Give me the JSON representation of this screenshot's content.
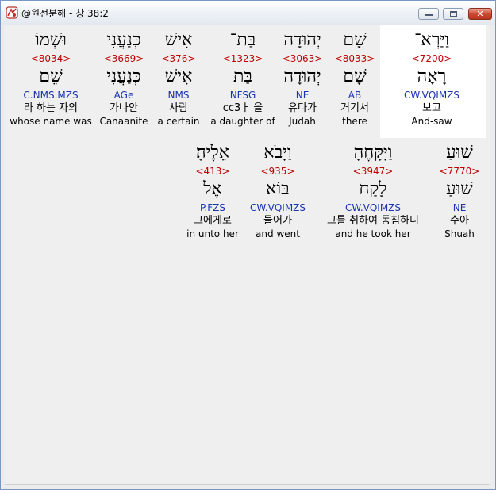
{
  "window": {
    "title": "@원전분해 - 창 38:2",
    "icon": "app-logo-icon",
    "close_glyph": "✕"
  },
  "colors": {
    "strong": "#c00000",
    "morph": "#1a33b0",
    "highlight": "#ffffff",
    "background": "#efefef"
  },
  "rows": [
    {
      "words": [
        {
          "hebrew": "וַיַּרְא־",
          "strong": "<7200>",
          "lemma": "רָאָה",
          "morph": "CW.VQIMZS",
          "korean": "보고",
          "english": "And-saw",
          "highlighted": true
        },
        {
          "hebrew": "שָׁם",
          "strong": "<8033>",
          "lemma": "שָׁם",
          "morph": "AB",
          "korean": "거기서",
          "english": "there"
        },
        {
          "hebrew": "יְהוּדָה",
          "strong": "<3063>",
          "lemma": "יְהוּדָה",
          "morph": "NE",
          "korean": "유다가",
          "english": "Judah"
        },
        {
          "hebrew": "בַּת־",
          "strong": "<1323>",
          "lemma": "בַּת",
          "morph": "NFSG",
          "korean": "cc3ㅏ 을",
          "english": "a daughter of"
        },
        {
          "hebrew": "אִישׁ",
          "strong": "<376>",
          "lemma": "אִישׁ",
          "morph": "NMS",
          "korean": "사람",
          "english": "a certain"
        },
        {
          "hebrew": "כְּנַעֲנִי",
          "strong": "<3669>",
          "lemma": "כְּנַעֲנִי",
          "morph": "AGe",
          "korean": "가나안",
          "english": "Canaanite"
        },
        {
          "hebrew": "וּשְׁמוֹ",
          "strong": "<8034>",
          "lemma": "שֵׁם",
          "morph": "C.NMS.MZS",
          "korean": "라 하는 자의",
          "english": "whose name was"
        }
      ]
    },
    {
      "words": [
        {
          "hebrew": "שׁוּעַ",
          "strong": "<7770>",
          "lemma": "שׁוּעַ",
          "morph": "NE",
          "korean": "수아",
          "english": "Shuah"
        },
        {
          "hebrew": "וַיִּקָּחֶהָ",
          "strong": "<3947>",
          "lemma": "לָקַח",
          "morph": "CW.VQIMZS",
          "korean": "그를 취하여 동침하니",
          "english": "and he took her"
        },
        {
          "hebrew": "וַיָּבֹא",
          "strong": "<935>",
          "lemma": "בּוֹא",
          "morph": "CW.VQIMZS",
          "korean": "들어가",
          "english": "and went"
        },
        {
          "hebrew": "אֵלֶיהָ׃",
          "strong": "<413>",
          "lemma": "אֶל",
          "morph": "P.FZS",
          "korean": "그에게로",
          "english": "in unto her"
        }
      ]
    }
  ]
}
